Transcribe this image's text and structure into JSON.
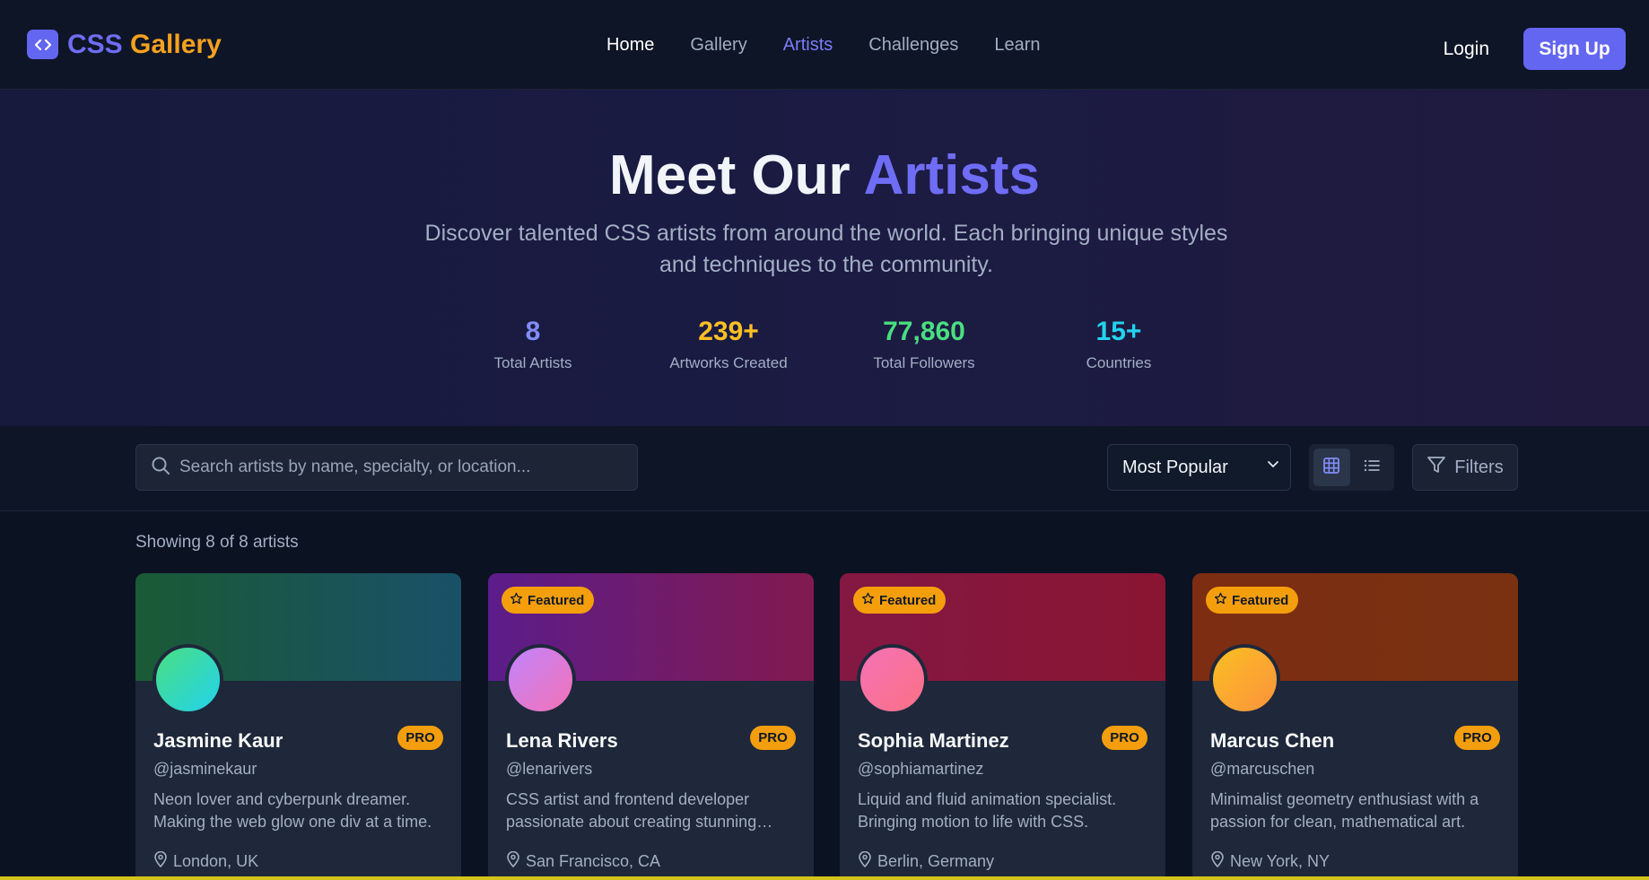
{
  "header": {
    "logo_icon": "code-brackets-icon",
    "logo_css": "CSS",
    "logo_gallery": "Gallery",
    "nav": [
      "Home",
      "Gallery",
      "Artists",
      "Challenges",
      "Learn"
    ],
    "active_nav": "Artists",
    "login": "Login",
    "signup": "Sign Up"
  },
  "hero": {
    "title_prefix": "Meet Our",
    "title_accent": "Artists",
    "subtitle": "Discover talented CSS artists from around the world. Each bringing unique styles and techniques to the community.",
    "stats": [
      {
        "value": "8",
        "label": "Total Artists",
        "color": "#818cf8"
      },
      {
        "value": "239+",
        "label": "Artworks Created",
        "color": "#fbbf24"
      },
      {
        "value": "77,860",
        "label": "Total Followers",
        "color": "#4ade80"
      },
      {
        "value": "15+",
        "label": "Countries",
        "color": "#22d3ee"
      }
    ]
  },
  "toolbar": {
    "search_placeholder": "Search artists by name, specialty, or location...",
    "sort_value": "Most Popular",
    "view_mode": "grid",
    "filters_label": "Filters"
  },
  "results": {
    "showing": "Showing 8 of 8 artists"
  },
  "artists": [
    {
      "name": "Jasmine Kaur",
      "handle": "@jasminekaur",
      "bio": "Neon lover and cyberpunk dreamer. Making the web glow one div at a time.",
      "location": "London, UK",
      "featured": false,
      "pro": "PRO",
      "banner_from": "#1a5a35",
      "banner_to": "#1a5068",
      "avatar_from": "#4ade80",
      "avatar_to": "#22d3ee"
    },
    {
      "name": "Lena Rivers",
      "handle": "@lenarivers",
      "bio": "CSS artist and frontend developer passionate about creating stunning visual experiences.",
      "location": "San Francisco, CA",
      "featured": true,
      "featured_label": "Featured",
      "pro": "PRO",
      "banner_from": "#5b1d8a",
      "banner_to": "#821a4e",
      "avatar_from": "#c084fc",
      "avatar_to": "#f472b6"
    },
    {
      "name": "Sophia Martinez",
      "handle": "@sophiamartinez",
      "bio": "Liquid and fluid animation specialist. Bringing motion to life with CSS.",
      "location": "Berlin, Germany",
      "featured": true,
      "featured_label": "Featured",
      "pro": "PRO",
      "banner_from": "#831843",
      "banner_to": "#8a1532",
      "avatar_from": "#f472b6",
      "avatar_to": "#fb7185"
    },
    {
      "name": "Marcus Chen",
      "handle": "@marcuschen",
      "bio": "Minimalist geometry enthusiast with a passion for clean, mathematical art.",
      "location": "New York, NY",
      "featured": true,
      "featured_label": "Featured",
      "pro": "PRO",
      "banner_from": "#7c2d12",
      "banner_to": "#7a3112",
      "avatar_from": "#fbbf24",
      "avatar_to": "#fb923c"
    }
  ]
}
